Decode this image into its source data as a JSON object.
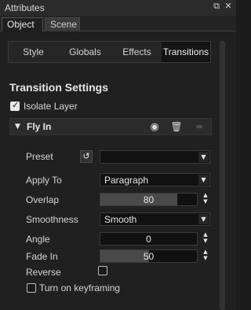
{
  "window": {
    "title": "Attributes",
    "icons": [
      "float-icon",
      "close-icon"
    ]
  },
  "top_tabs": [
    {
      "label": "Object",
      "active": true
    },
    {
      "label": "Scene",
      "active": false
    }
  ],
  "sub_tabs": [
    {
      "label": "Style",
      "active": false
    },
    {
      "label": "Globals",
      "active": false
    },
    {
      "label": "Effects",
      "active": false
    },
    {
      "label": "Transitions",
      "active": true
    }
  ],
  "section": {
    "title": "Transition Settings",
    "isolate_layer": {
      "label": "Isolate Layer",
      "checked": true
    }
  },
  "transition": {
    "name": "Fly In",
    "expanded": true,
    "icons": [
      "eye-icon",
      "trash-icon",
      "menu-icon"
    ]
  },
  "fields": {
    "preset": {
      "label": "Preset",
      "value": ""
    },
    "apply_to": {
      "label": "Apply To",
      "value": "Paragraph"
    },
    "overlap": {
      "label": "Overlap",
      "value": "80",
      "fill_fraction": 0.8
    },
    "smoothness": {
      "label": "Smoothness",
      "value": "Smooth"
    },
    "angle": {
      "label": "Angle",
      "value": "0"
    },
    "fade_in": {
      "label": "Fade In",
      "value": "50",
      "fill_fraction": 0.5
    },
    "reverse": {
      "label": "Reverse",
      "checked": false
    }
  },
  "keyframing": {
    "label": "Turn on keyframing",
    "checked": false
  },
  "colors": {
    "background": "#202020",
    "titlebar": "#2b2b2b",
    "field": "#111111",
    "slider_fill": "#4a4a4a",
    "text": "#dcdcdc"
  }
}
